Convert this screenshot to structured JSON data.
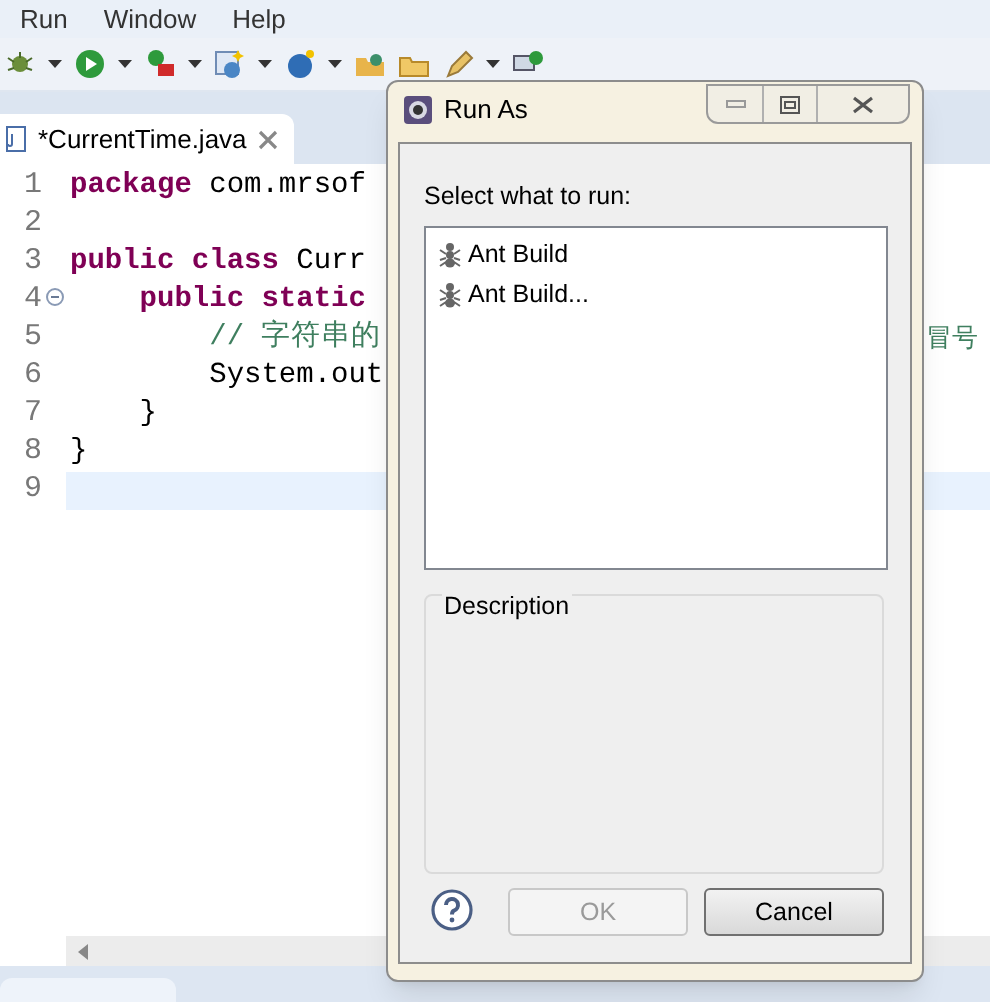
{
  "menu": [
    {
      "label": "Run"
    },
    {
      "label": "Window"
    },
    {
      "label": "Help"
    }
  ],
  "editor_tab": {
    "label": "*CurrentTime.java"
  },
  "code_lines": [
    {
      "number": "1",
      "selected": false,
      "fold_marker": false,
      "tokens": [
        {
          "kind": "keyword",
          "text": "package"
        },
        {
          "kind": "plain",
          "text": " com.mrsof"
        }
      ]
    },
    {
      "number": "2",
      "selected": false,
      "fold_marker": false
    },
    {
      "number": "3",
      "selected": false,
      "fold_marker": false,
      "tokens": [
        {
          "kind": "keyword",
          "text": "public class"
        },
        {
          "kind": "plain",
          "text": " Curr"
        }
      ]
    },
    {
      "number": "4",
      "selected": false,
      "fold_marker": true,
      "tokens": [
        {
          "kind": "keyword",
          "text": "    public static"
        }
      ]
    },
    {
      "number": "5",
      "selected": false,
      "fold_marker": false,
      "tokens": [
        {
          "kind": "comment",
          "text": "        // 字符串的"
        }
      ],
      "right_fragment": "冒号"
    },
    {
      "number": "6",
      "selected": false,
      "fold_marker": false,
      "tokens": [
        {
          "kind": "plain",
          "text": "        System.out"
        }
      ]
    },
    {
      "number": "7",
      "selected": false,
      "fold_marker": false,
      "tokens": [
        {
          "kind": "plain",
          "text": "    }"
        }
      ]
    },
    {
      "number": "8",
      "selected": false,
      "fold_marker": false,
      "tokens": [
        {
          "kind": "plain",
          "text": "}"
        }
      ]
    },
    {
      "number": "9",
      "selected": true,
      "fold_marker": false
    }
  ],
  "dialog": {
    "title": "Run As",
    "prompt": "Select what to run:",
    "items": [
      {
        "label": "Ant Build",
        "selected": false
      },
      {
        "label": "Ant Build...",
        "selected": false
      }
    ],
    "description_label": "Description",
    "buttons": [
      {
        "label": "OK",
        "disabled": true
      },
      {
        "label": "Cancel",
        "disabled": false
      }
    ]
  }
}
